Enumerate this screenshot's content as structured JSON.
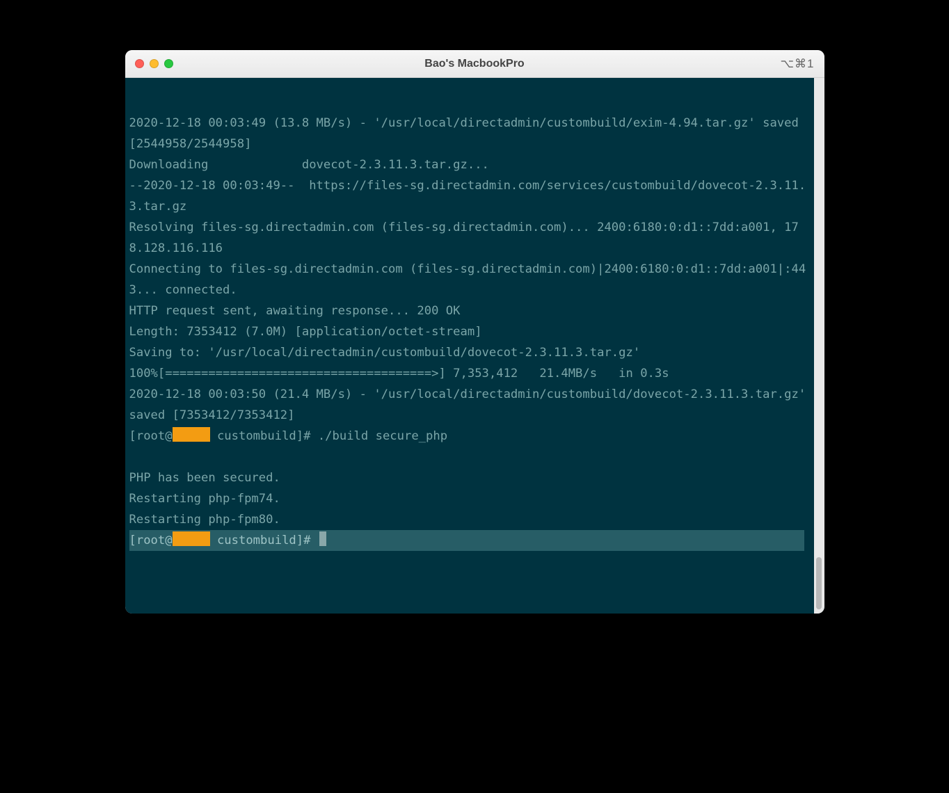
{
  "window": {
    "title": "Bao's MacbookPro",
    "shortcut": "⌥⌘1"
  },
  "terminal": {
    "lines": [
      "2020-12-18 00:03:49 (13.8 MB/s) - '/usr/local/directadmin/custombuild/exim-4.94.tar.gz' saved [2544958/2544958]",
      "",
      "Downloading             dovecot-2.3.11.3.tar.gz...",
      "--2020-12-18 00:03:49--  https://files-sg.directadmin.com/services/custombuild/dovecot-2.3.11.3.tar.gz",
      "Resolving files-sg.directadmin.com (files-sg.directadmin.com)... 2400:6180:0:d1::7dd:a001, 178.128.116.116",
      "Connecting to files-sg.directadmin.com (files-sg.directadmin.com)|2400:6180:0:d1::7dd:a001|:443... connected.",
      "HTTP request sent, awaiting response... 200 OK",
      "Length: 7353412 (7.0M) [application/octet-stream]",
      "Saving to: '/usr/local/directadmin/custombuild/dovecot-2.3.11.3.tar.gz'",
      "",
      "100%[=====================================>] 7,353,412   21.4MB/s   in 0.3s",
      "",
      "2020-12-18 00:03:50 (21.4 MB/s) - '/usr/local/directadmin/custombuild/dovecot-2.3.11.3.tar.gz' saved [7353412/7353412]",
      ""
    ],
    "prompt1_pre": "[root@",
    "prompt1_post": " custombuild]# ",
    "command1": "./build secure_php",
    "output": [
      "PHP has been secured.",
      "Restarting php-fpm74.",
      "Restarting php-fpm80."
    ],
    "prompt2_pre": "[root@",
    "prompt2_post": " custombuild]# "
  }
}
